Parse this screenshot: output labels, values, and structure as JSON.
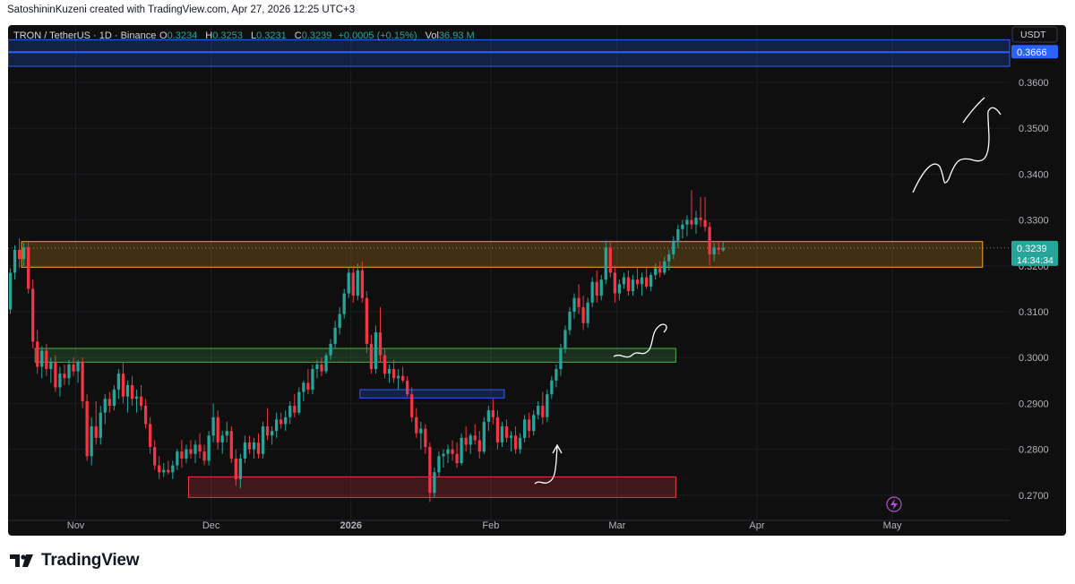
{
  "header": {
    "attribution": "SatoshininKuzeni created with TradingView.com, Apr 27, 2026 12:25 UTC+3"
  },
  "footer": {
    "brand": "TradingView"
  },
  "legend": {
    "symbol": "TRON / TetherUS · 1D · Binance",
    "open_label": "O",
    "open": "0.3234",
    "high_label": "H",
    "high": "0.3253",
    "low_label": "L",
    "low": "0.3231",
    "close_label": "C",
    "close": "0.3239",
    "change": "+0.0005 (+0.15%)",
    "vol_label": "Vol",
    "vol": "36.93 M"
  },
  "colors": {
    "up": "#26a69a",
    "down": "#f23645",
    "accent": "#2962ff",
    "zone_orange": "#f5a623",
    "zone_green": "#4caf50",
    "zone_red": "#f23645",
    "zone_blue": "#2962ff"
  },
  "chart_data": {
    "type": "candlestick",
    "currency": "USDT",
    "price_axis": {
      "ticks": [
        0.36,
        0.35,
        0.34,
        0.33,
        0.32,
        0.31,
        0.3,
        0.29,
        0.28,
        0.27
      ],
      "tick_labels": [
        "0.3600",
        "0.3500",
        "0.3400",
        "0.3300",
        "0.3200",
        "0.3100",
        "0.3000",
        "0.2900",
        "0.2800",
        "0.2700"
      ],
      "range": [
        0.2645,
        0.3725
      ]
    },
    "time_axis": {
      "start": "2025-10-17",
      "end": "2026-05-27",
      "ticks": [
        {
          "date": "2025-11-01",
          "label": "Nov"
        },
        {
          "date": "2025-12-01",
          "label": "Dec"
        },
        {
          "date": "2026-01-01",
          "label": "2026"
        },
        {
          "date": "2026-02-01",
          "label": "Feb"
        },
        {
          "date": "2026-03-01",
          "label": "Mar"
        },
        {
          "date": "2026-04-01",
          "label": "Apr"
        },
        {
          "date": "2026-05-01",
          "label": "May"
        }
      ]
    },
    "first_candle_date": "2025-10-17",
    "candles": [
      [
        0.3105,
        0.3195,
        0.3095,
        0.3185
      ],
      [
        0.3185,
        0.3245,
        0.317,
        0.3235
      ],
      [
        0.3235,
        0.326,
        0.3195,
        0.3215
      ],
      [
        0.3215,
        0.325,
        0.32,
        0.324
      ],
      [
        0.324,
        0.3255,
        0.314,
        0.315
      ],
      [
        0.315,
        0.317,
        0.302,
        0.3035
      ],
      [
        0.3035,
        0.306,
        0.2965,
        0.298
      ],
      [
        0.298,
        0.3025,
        0.2955,
        0.3015
      ],
      [
        0.3015,
        0.303,
        0.296,
        0.2975
      ],
      [
        0.2975,
        0.3,
        0.2945,
        0.299
      ],
      [
        0.299,
        0.3005,
        0.2925,
        0.2935
      ],
      [
        0.2935,
        0.298,
        0.2915,
        0.2965
      ],
      [
        0.2965,
        0.2985,
        0.294,
        0.2955
      ],
      [
        0.2955,
        0.2995,
        0.294,
        0.2985
      ],
      [
        0.2985,
        0.3,
        0.296,
        0.297
      ],
      [
        0.297,
        0.2995,
        0.2945,
        0.299
      ],
      [
        0.299,
        0.3,
        0.289,
        0.2905
      ],
      [
        0.2905,
        0.292,
        0.2775,
        0.2785
      ],
      [
        0.2785,
        0.287,
        0.2765,
        0.285
      ],
      [
        0.285,
        0.2905,
        0.281,
        0.2825
      ],
      [
        0.2825,
        0.2895,
        0.281,
        0.288
      ],
      [
        0.288,
        0.292,
        0.2855,
        0.291
      ],
      [
        0.291,
        0.2925,
        0.288,
        0.2895
      ],
      [
        0.2895,
        0.294,
        0.2885,
        0.293
      ],
      [
        0.293,
        0.2975,
        0.291,
        0.2965
      ],
      [
        0.2965,
        0.299,
        0.29,
        0.2915
      ],
      [
        0.2915,
        0.295,
        0.288,
        0.294
      ],
      [
        0.294,
        0.296,
        0.2895,
        0.291
      ],
      [
        0.291,
        0.293,
        0.288,
        0.2915
      ],
      [
        0.2915,
        0.294,
        0.2885,
        0.2895
      ],
      [
        0.2895,
        0.291,
        0.2845,
        0.2855
      ],
      [
        0.2855,
        0.287,
        0.279,
        0.2805
      ],
      [
        0.2805,
        0.282,
        0.2755,
        0.2765
      ],
      [
        0.2765,
        0.2785,
        0.2735,
        0.275
      ],
      [
        0.275,
        0.277,
        0.274,
        0.2755
      ],
      [
        0.2755,
        0.2775,
        0.2745,
        0.275
      ],
      [
        0.275,
        0.2775,
        0.2735,
        0.2765
      ],
      [
        0.2765,
        0.28,
        0.2755,
        0.2795
      ],
      [
        0.2795,
        0.282,
        0.276,
        0.278
      ],
      [
        0.278,
        0.281,
        0.277,
        0.28
      ],
      [
        0.28,
        0.282,
        0.278,
        0.279
      ],
      [
        0.279,
        0.282,
        0.277,
        0.281
      ],
      [
        0.281,
        0.2835,
        0.278,
        0.2795
      ],
      [
        0.2795,
        0.281,
        0.2765,
        0.2775
      ],
      [
        0.2775,
        0.284,
        0.2765,
        0.283
      ],
      [
        0.283,
        0.29,
        0.2815,
        0.287
      ],
      [
        0.287,
        0.2885,
        0.28,
        0.2815
      ],
      [
        0.2815,
        0.284,
        0.279,
        0.283
      ],
      [
        0.283,
        0.286,
        0.2815,
        0.284
      ],
      [
        0.284,
        0.285,
        0.277,
        0.278
      ],
      [
        0.278,
        0.28,
        0.272,
        0.2735
      ],
      [
        0.2735,
        0.279,
        0.2715,
        0.278
      ],
      [
        0.278,
        0.283,
        0.277,
        0.2815
      ],
      [
        0.2815,
        0.283,
        0.279,
        0.28
      ],
      [
        0.28,
        0.2825,
        0.278,
        0.2815
      ],
      [
        0.2815,
        0.2835,
        0.278,
        0.279
      ],
      [
        0.279,
        0.286,
        0.278,
        0.285
      ],
      [
        0.285,
        0.289,
        0.282,
        0.283
      ],
      [
        0.283,
        0.285,
        0.281,
        0.284
      ],
      [
        0.284,
        0.288,
        0.2825,
        0.2865
      ],
      [
        0.2865,
        0.288,
        0.2845,
        0.2855
      ],
      [
        0.2855,
        0.2885,
        0.284,
        0.287
      ],
      [
        0.287,
        0.2905,
        0.2855,
        0.2895
      ],
      [
        0.2895,
        0.292,
        0.287,
        0.288
      ],
      [
        0.288,
        0.2935,
        0.2875,
        0.2925
      ],
      [
        0.2925,
        0.295,
        0.2905,
        0.2945
      ],
      [
        0.2945,
        0.2975,
        0.292,
        0.293
      ],
      [
        0.293,
        0.2985,
        0.292,
        0.2975
      ],
      [
        0.2975,
        0.2995,
        0.2955,
        0.2985
      ],
      [
        0.2985,
        0.3,
        0.296,
        0.297
      ],
      [
        0.297,
        0.301,
        0.2965,
        0.3005
      ],
      [
        0.3005,
        0.304,
        0.2995,
        0.303
      ],
      [
        0.303,
        0.308,
        0.302,
        0.3065
      ],
      [
        0.3065,
        0.311,
        0.305,
        0.3095
      ],
      [
        0.3095,
        0.315,
        0.3085,
        0.314
      ],
      [
        0.314,
        0.3195,
        0.313,
        0.3185
      ],
      [
        0.3185,
        0.32,
        0.312,
        0.3135
      ],
      [
        0.3135,
        0.3205,
        0.3125,
        0.319
      ],
      [
        0.319,
        0.321,
        0.312,
        0.313
      ],
      [
        0.313,
        0.3145,
        0.301,
        0.303
      ],
      [
        0.303,
        0.305,
        0.2965,
        0.2975
      ],
      [
        0.2975,
        0.307,
        0.2965,
        0.3055
      ],
      [
        0.3055,
        0.311,
        0.299,
        0.3005
      ],
      [
        0.3005,
        0.302,
        0.2955,
        0.2965
      ],
      [
        0.2965,
        0.2985,
        0.2945,
        0.2975
      ],
      [
        0.2975,
        0.2995,
        0.2945,
        0.2955
      ],
      [
        0.2955,
        0.2975,
        0.293,
        0.296
      ],
      [
        0.296,
        0.298,
        0.2945,
        0.295
      ],
      [
        0.295,
        0.296,
        0.2915,
        0.292
      ],
      [
        0.292,
        0.2935,
        0.286,
        0.287
      ],
      [
        0.287,
        0.289,
        0.2825,
        0.2835
      ],
      [
        0.2835,
        0.286,
        0.28,
        0.2845
      ],
      [
        0.2845,
        0.2855,
        0.279,
        0.2805
      ],
      [
        0.2805,
        0.2815,
        0.2685,
        0.2705
      ],
      [
        0.2705,
        0.276,
        0.2695,
        0.275
      ],
      [
        0.275,
        0.2795,
        0.274,
        0.2785
      ],
      [
        0.2785,
        0.28,
        0.276,
        0.279
      ],
      [
        0.279,
        0.281,
        0.277,
        0.28
      ],
      [
        0.28,
        0.282,
        0.2775,
        0.279
      ],
      [
        0.279,
        0.2815,
        0.276,
        0.277
      ],
      [
        0.277,
        0.2835,
        0.2765,
        0.2825
      ],
      [
        0.2825,
        0.285,
        0.2795,
        0.281
      ],
      [
        0.281,
        0.2835,
        0.279,
        0.283
      ],
      [
        0.283,
        0.2855,
        0.281,
        0.282
      ],
      [
        0.282,
        0.284,
        0.278,
        0.2795
      ],
      [
        0.2795,
        0.287,
        0.279,
        0.286
      ],
      [
        0.286,
        0.2895,
        0.284,
        0.2885
      ],
      [
        0.2885,
        0.291,
        0.2855,
        0.287
      ],
      [
        0.287,
        0.2885,
        0.28,
        0.2815
      ],
      [
        0.2815,
        0.286,
        0.2805,
        0.285
      ],
      [
        0.285,
        0.2865,
        0.2815,
        0.2825
      ],
      [
        0.2825,
        0.284,
        0.2795,
        0.283
      ],
      [
        0.283,
        0.285,
        0.279,
        0.28
      ],
      [
        0.28,
        0.2835,
        0.279,
        0.2825
      ],
      [
        0.2825,
        0.2875,
        0.2815,
        0.2865
      ],
      [
        0.2865,
        0.288,
        0.2825,
        0.284
      ],
      [
        0.284,
        0.2885,
        0.283,
        0.2875
      ],
      [
        0.2875,
        0.2905,
        0.2865,
        0.2895
      ],
      [
        0.2895,
        0.2925,
        0.2855,
        0.287
      ],
      [
        0.287,
        0.293,
        0.286,
        0.292
      ],
      [
        0.292,
        0.296,
        0.291,
        0.295
      ],
      [
        0.295,
        0.2985,
        0.2935,
        0.2975
      ],
      [
        0.2975,
        0.303,
        0.296,
        0.302
      ],
      [
        0.302,
        0.307,
        0.301,
        0.306
      ],
      [
        0.306,
        0.311,
        0.305,
        0.31
      ],
      [
        0.31,
        0.314,
        0.3085,
        0.313
      ],
      [
        0.313,
        0.316,
        0.3095,
        0.311
      ],
      [
        0.311,
        0.3135,
        0.306,
        0.3075
      ],
      [
        0.3075,
        0.313,
        0.3065,
        0.312
      ],
      [
        0.312,
        0.3175,
        0.311,
        0.3165
      ],
      [
        0.3165,
        0.319,
        0.312,
        0.3135
      ],
      [
        0.3135,
        0.318,
        0.3125,
        0.317
      ],
      [
        0.317,
        0.3255,
        0.316,
        0.324
      ],
      [
        0.324,
        0.3255,
        0.3175,
        0.3185
      ],
      [
        0.3185,
        0.32,
        0.312,
        0.314
      ],
      [
        0.314,
        0.317,
        0.3125,
        0.316
      ],
      [
        0.316,
        0.3185,
        0.315,
        0.3175
      ],
      [
        0.3175,
        0.319,
        0.3135,
        0.3145
      ],
      [
        0.3145,
        0.318,
        0.3135,
        0.317
      ],
      [
        0.317,
        0.3195,
        0.315,
        0.316
      ],
      [
        0.316,
        0.3185,
        0.3135,
        0.3175
      ],
      [
        0.3175,
        0.3195,
        0.315,
        0.3155
      ],
      [
        0.3155,
        0.3185,
        0.3145,
        0.318
      ],
      [
        0.318,
        0.3205,
        0.317,
        0.3195
      ],
      [
        0.3195,
        0.321,
        0.3175,
        0.3185
      ],
      [
        0.3185,
        0.322,
        0.318,
        0.321
      ],
      [
        0.321,
        0.3235,
        0.319,
        0.3225
      ],
      [
        0.3225,
        0.3265,
        0.3215,
        0.3255
      ],
      [
        0.3255,
        0.329,
        0.324,
        0.328
      ],
      [
        0.328,
        0.33,
        0.326,
        0.329
      ],
      [
        0.329,
        0.331,
        0.3265,
        0.33
      ],
      [
        0.33,
        0.3365,
        0.328,
        0.329
      ],
      [
        0.329,
        0.332,
        0.327,
        0.3305
      ],
      [
        0.3305,
        0.335,
        0.3285,
        0.33
      ],
      [
        0.33,
        0.335,
        0.3275,
        0.3285
      ],
      [
        0.3285,
        0.3295,
        0.32,
        0.3225
      ],
      [
        0.3225,
        0.325,
        0.321,
        0.324
      ],
      [
        0.324,
        0.3255,
        0.3225,
        0.3235
      ],
      [
        0.3234,
        0.3253,
        0.3231,
        0.3239
      ]
    ],
    "zones": [
      {
        "name": "resistance-zone",
        "from": "2025-10-17",
        "to": "2026-05-27",
        "low": 0.3635,
        "high": 0.3693,
        "color": "#2962ff",
        "line": 0.3666
      },
      {
        "name": "supply-zone",
        "from": "2025-10-20",
        "to": "2026-05-21",
        "low": 0.3197,
        "high": 0.3253,
        "color": "#f5a623"
      },
      {
        "name": "mid-zone",
        "from": "2025-10-23",
        "to": "2026-03-14",
        "low": 0.299,
        "high": 0.302,
        "color": "#4caf50"
      },
      {
        "name": "small-zone",
        "from": "2026-01-03",
        "to": "2026-02-04",
        "low": 0.2912,
        "high": 0.293,
        "color": "#2962ff"
      },
      {
        "name": "demand-zone",
        "from": "2025-11-26",
        "to": "2026-03-14",
        "low": 0.2695,
        "high": 0.274,
        "color": "#f23645"
      }
    ],
    "price_labels": [
      {
        "name": "price-label-resistance",
        "value": 0.3666,
        "text": "0.3666",
        "bg": "#2962ff",
        "color": "#ffffff"
      },
      {
        "name": "price-label-last",
        "value": 0.3239,
        "text": "0.3239",
        "subtext": "14:34:34",
        "bg": "#26a69a",
        "color": "#ffffff"
      }
    ]
  }
}
